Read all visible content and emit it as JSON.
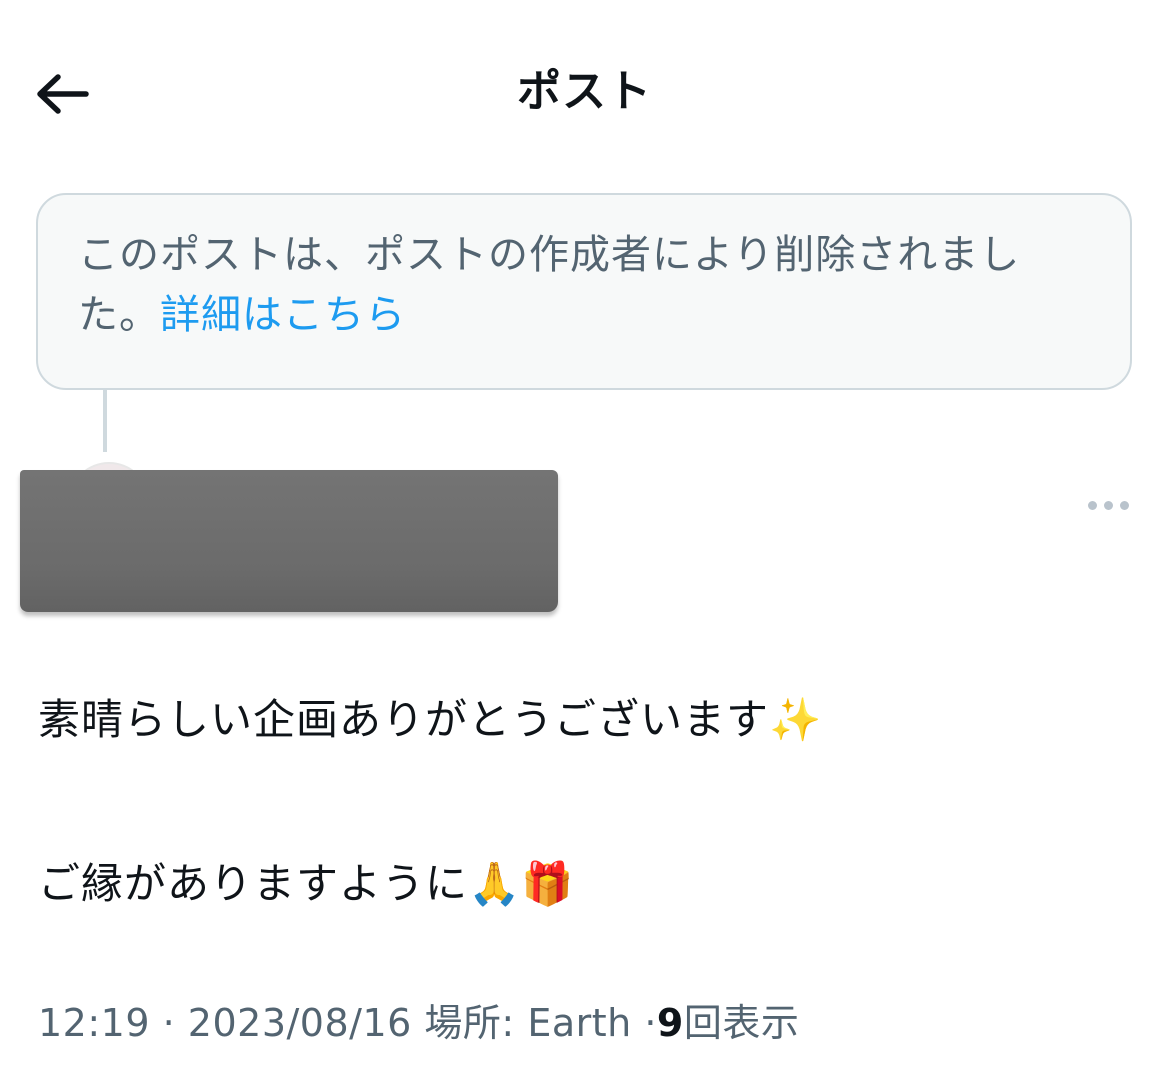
{
  "header": {
    "title": "ポスト",
    "back_icon": "arrow-left-icon"
  },
  "deleted_notice": {
    "text": "このポストは、ポストの作成者により削除されました。",
    "link_label": "詳細はこちら"
  },
  "post": {
    "more_icon": "more-options-icon",
    "line1": "素晴らしい企画ありがとうございます✨",
    "line2": "ご縁がありますように🙏🎁",
    "time": "12:19",
    "separator": "·",
    "date": "2023/08/16",
    "location_label": "場所:",
    "location": "Earth",
    "view_count": "9",
    "view_label": "回表示"
  },
  "colors": {
    "text_primary": "#0f1419",
    "text_secondary": "#536471",
    "link": "#1d9bf0",
    "border": "#cfd9de",
    "notice_bg": "#f7f9f9"
  }
}
